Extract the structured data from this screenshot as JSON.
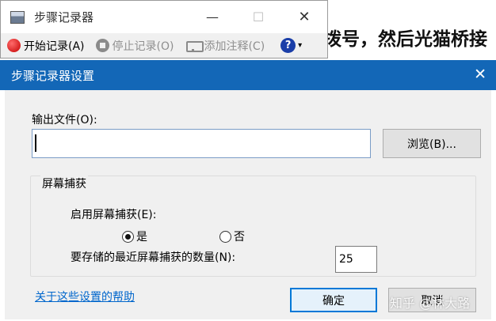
{
  "background_page": {
    "text": "拨号，然后光猫桥接"
  },
  "steps_recorder": {
    "title": "步骤记录器",
    "toolbar": {
      "start_record": "开始记录(A)",
      "stop_record": "停止记录(O)",
      "add_comment": "添加注释(C)",
      "help_symbol": "?",
      "dropdown_symbol": "▾"
    },
    "window_controls": {
      "minimize": "—",
      "maximize": "☐",
      "close": "✕"
    }
  },
  "settings_dialog": {
    "title": "步骤记录器设置",
    "close_symbol": "✕",
    "output_file": {
      "label": "输出文件(O):",
      "value": "",
      "browse_label": "浏览(B)..."
    },
    "screen_capture": {
      "group_label": "屏幕捕获",
      "enable_label": "启用屏幕捕获(E):",
      "options": [
        {
          "label": "是",
          "selected": true
        },
        {
          "label": "否",
          "selected": false
        }
      ],
      "count_label": "要存储的最近屏幕捕获的数量(N):",
      "count_value": "25"
    },
    "help_link": "关于这些设置的帮助",
    "ok_label": "确定",
    "cancel_label": "取消"
  },
  "watermark": "知乎 @林大路",
  "colors": {
    "title_bar": "#1367b7",
    "link": "#0066cc",
    "ok_border": "#0078d7"
  }
}
